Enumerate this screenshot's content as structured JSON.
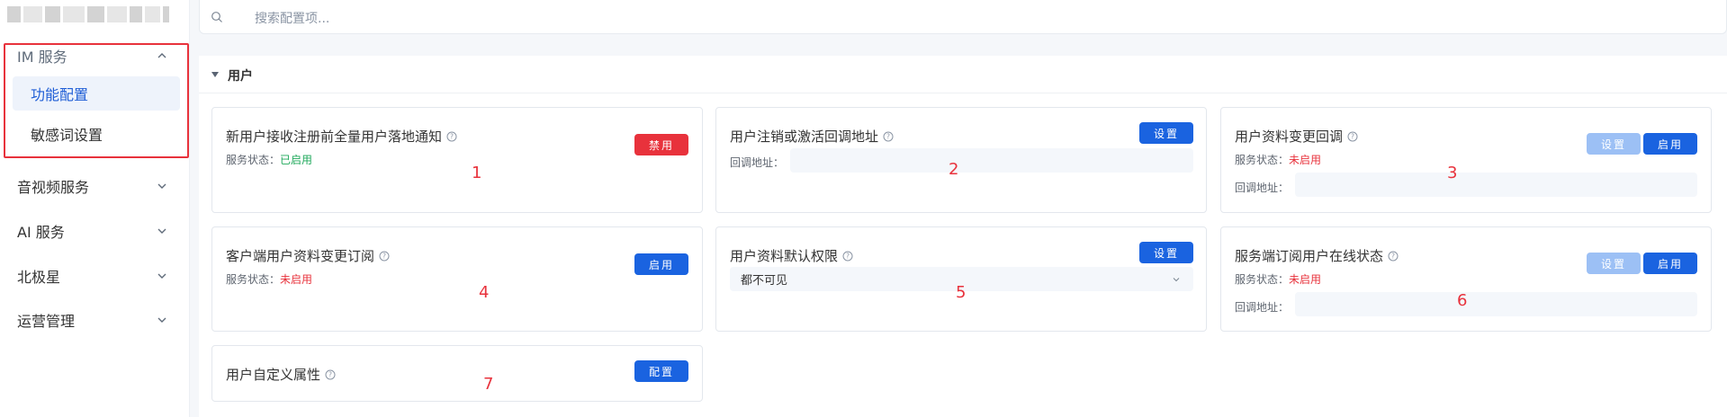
{
  "search": {
    "placeholder": "搜索配置项..."
  },
  "sidebar": {
    "im": {
      "label": "IM 服务",
      "items": [
        {
          "label": "功能配置",
          "active": true
        },
        {
          "label": "敏感词设置",
          "active": false
        }
      ]
    },
    "others": [
      {
        "label": "音视频服务"
      },
      {
        "label": "AI 服务"
      },
      {
        "label": "北极星"
      },
      {
        "label": "运营管理"
      }
    ]
  },
  "section": {
    "title": "用户"
  },
  "cards": [
    {
      "title": "新用户接收注册前全量用户落地通知",
      "status_label": "服务状态：",
      "status": "已启用",
      "button": "禁用",
      "num": "1"
    },
    {
      "title": "用户注销或激活回调地址",
      "url_label": "回调地址：",
      "button": "设置",
      "num": "2"
    },
    {
      "title": "用户资料变更回调",
      "status_label": "服务状态：",
      "status": "未启用",
      "url_label": "回调地址：",
      "button_disabled": "设置",
      "button": "启用",
      "num": "3"
    },
    {
      "title": "客户端用户资料变更订阅",
      "status_label": "服务状态：",
      "status": "未启用",
      "button": "启用",
      "num": "4"
    },
    {
      "title": "用户资料默认权限",
      "select_value": "都不可见",
      "button": "设置",
      "num": "5"
    },
    {
      "title": "服务端订阅用户在线状态",
      "status_label": "服务状态：",
      "status": "未启用",
      "url_label": "回调地址：",
      "button_disabled": "设置",
      "button": "启用",
      "num": "6"
    },
    {
      "title": "用户自定义属性",
      "button": "配置",
      "num": "7"
    }
  ],
  "colors": {
    "accent": "#1a63e0",
    "danger": "#e8323c",
    "success": "#1ea85a",
    "highlight_border": "#e8323c"
  }
}
